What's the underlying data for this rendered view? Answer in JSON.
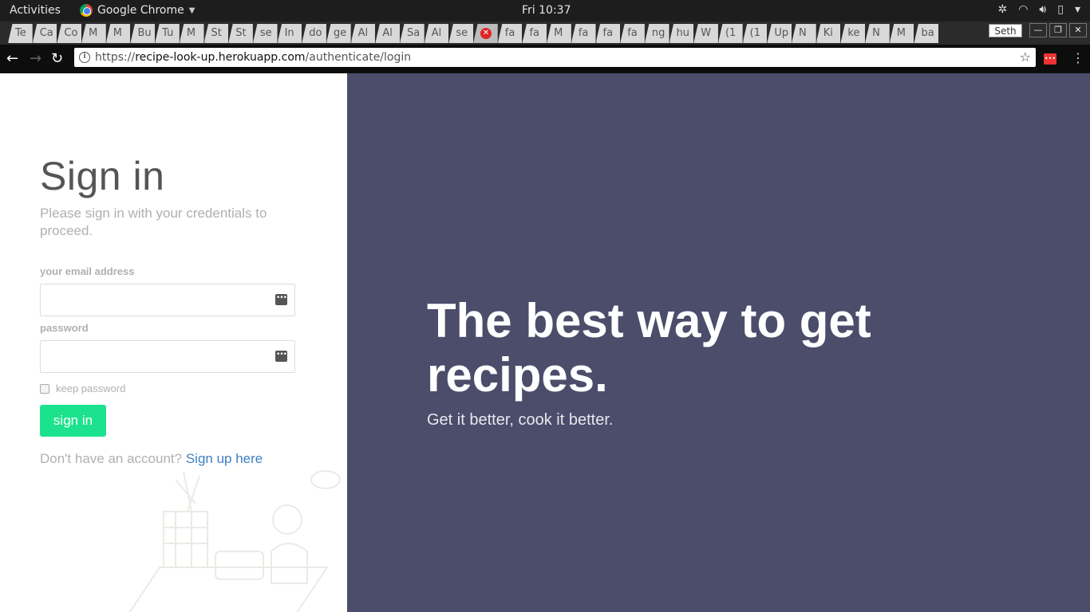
{
  "system_bar": {
    "activities": "Activities",
    "app_name": "Google Chrome",
    "clock": "Fri 10:37"
  },
  "browser": {
    "tabs": [
      "Te",
      "Ca",
      "Co",
      "M",
      "M",
      "Bu",
      "Tu",
      "M",
      "St",
      "St",
      "se",
      "In",
      "do",
      "ge",
      "Al",
      "Al",
      "Sa",
      "Al",
      "se",
      "",
      "fa",
      "fa",
      "M",
      "fa",
      "fa",
      "fa",
      "ng",
      "hu",
      "W",
      "(1",
      "(1",
      "Up",
      "N",
      "Ki",
      "ke",
      "N",
      "M",
      "ba"
    ],
    "profile_name": "Seth",
    "url_scheme": "https://",
    "url_domain": "recipe-look-up.herokuapp.com",
    "url_path": "/authenticate/login"
  },
  "login": {
    "title": "Sign in",
    "subtitle": "Please sign in with your credentials to proceed.",
    "email_label": "your email address",
    "email_value": "",
    "password_label": "password",
    "password_value": "",
    "keep_password_label": "keep password",
    "signin_button": "sign in",
    "no_account_text": "Don't have an account?",
    "signup_link": "Sign up here"
  },
  "hero": {
    "headline": "The best way to get recipes.",
    "tagline": "Get it better, cook it better."
  },
  "colors": {
    "accent_green": "#1de28d",
    "hero_background": "#4b4d6a",
    "link_blue": "#3f7fc4"
  }
}
